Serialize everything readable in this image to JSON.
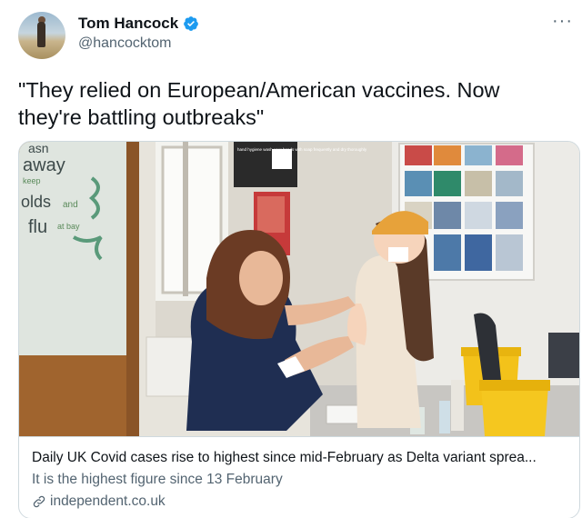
{
  "author": {
    "name": "Tom Hancock",
    "handle": "@hancocktom"
  },
  "more_label": "···",
  "tweet_text": "\"They relied on European/American vaccines. Now they're battling outbreaks\"",
  "card": {
    "title": "Daily UK Covid cases rise to highest since mid-February as Delta variant sprea...",
    "description": "It is the highest figure since 13 February",
    "domain": "independent.co.uk",
    "image_text": {
      "poster_word_1": "asn",
      "poster_word_2": "away",
      "poster_word_3": "keep",
      "poster_word_4": "olds",
      "poster_word_5": "and",
      "poster_word_6": "flu",
      "poster_word_7": "at bay",
      "notice_text": "hand hygiene wash your hands with soap frequently and dry thoroughly"
    }
  },
  "colors": {
    "verified": "#1d9bf0",
    "secondary_text": "#536471",
    "border": "#cfd9de"
  }
}
